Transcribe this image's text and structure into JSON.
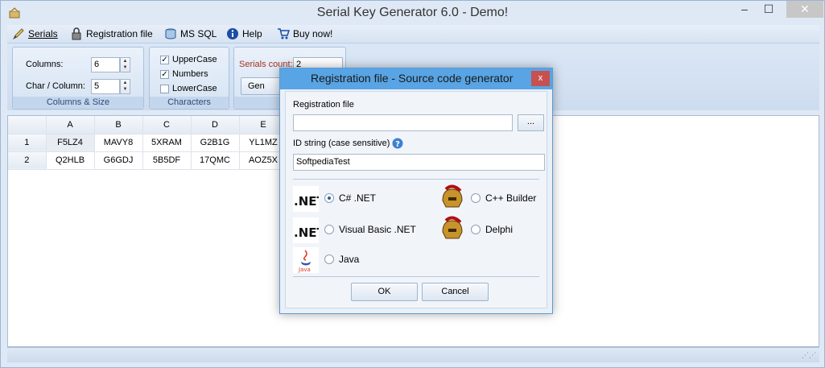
{
  "window": {
    "title": "Serial Key Generator 6.0 - Demo!",
    "minimize": "–",
    "maximize": "☐",
    "close": "✕"
  },
  "menu": {
    "serials": "Serials",
    "serials_icon": "pen-icon",
    "registration_file": "Registration file",
    "registration_icon": "lock-icon",
    "ms_sql": "MS SQL",
    "ms_sql_icon": "database-icon",
    "help": "Help",
    "help_icon": "info-icon",
    "buy_now": "Buy now!",
    "buy_icon": "cart-icon"
  },
  "ribbon": {
    "columns_size": {
      "label": "Columns & Size",
      "columns_label": "Columns:",
      "columns_value": "6",
      "char_label": "Char / Column:",
      "char_value": "5"
    },
    "characters": {
      "label": "Characters",
      "uppercase": "UpperCase",
      "uppercase_checked": true,
      "numbers": "Numbers",
      "numbers_checked": true,
      "lowercase": "LowerCase",
      "lowercase_checked": false
    },
    "generate": {
      "label": "Gen",
      "serials_count_label": "Serials count:",
      "serials_count_value": "2",
      "button_label": "Gen"
    }
  },
  "grid": {
    "columns": [
      "A",
      "B",
      "C",
      "D",
      "E"
    ],
    "rows": [
      {
        "num": "1",
        "cells": [
          "F5LZ4",
          "MAVY8",
          "5XRAM",
          "G2B1G",
          "YL1MZ"
        ]
      },
      {
        "num": "2",
        "cells": [
          "Q2HLB",
          "G6GDJ",
          "5B5DF",
          "17QMC",
          "AOZ5X"
        ]
      }
    ]
  },
  "dialog": {
    "title": "Registration file - Source code generator",
    "close": "x",
    "registration_file_label": "Registration file",
    "registration_file_value": "",
    "browse_button": "...",
    "id_string_label": "ID string (case sensitive)",
    "id_string_value": "SoftpediaTest",
    "options": [
      {
        "label": "C# .NET",
        "selected": true,
        "logo": "dotnet-logo"
      },
      {
        "label": "C++ Builder",
        "selected": false,
        "logo": "cppbuilder-logo"
      },
      {
        "label": "Visual Basic .NET",
        "selected": false,
        "logo": "dotnet-logo"
      },
      {
        "label": "Delphi",
        "selected": false,
        "logo": "delphi-logo"
      },
      {
        "label": "Java",
        "selected": false,
        "logo": "java-logo"
      }
    ],
    "ok": "OK",
    "cancel": "Cancel"
  }
}
